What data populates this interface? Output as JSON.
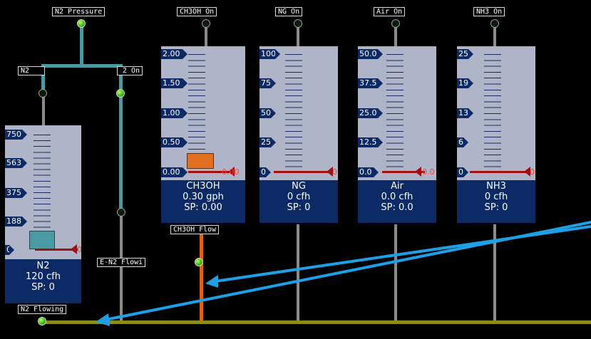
{
  "tags": {
    "n2_pressure": "N2 Pressure",
    "ch3oh_on": "CH3OH On",
    "ng_on": "NG On",
    "air_on": "Air On",
    "nh3_on": "NH3 On",
    "n2_left": "N2",
    "n2_right": "2 On",
    "e_n2_flowing": "E-N2 Flowi",
    "ch3oh_flow": "CH3OH Flow",
    "n2_flowing": "N2 Flowing"
  },
  "gauges": {
    "ch3oh": {
      "ticks": [
        "2.00",
        "1.50",
        "1.00",
        "0.50",
        "0.00"
      ],
      "zero_value": "0.00",
      "name": "CH3OH",
      "value": "0.30 gph",
      "setpoint": "SP: 0.00"
    },
    "ng": {
      "ticks": [
        "100",
        "75",
        "50",
        "25",
        "0"
      ],
      "zero_value": "0",
      "name": "NG",
      "value": "0 cfh",
      "setpoint": "SP: 0"
    },
    "air": {
      "ticks": [
        "50.0",
        "37.5",
        "25.0",
        "12.5",
        "0.0"
      ],
      "zero_value": "0.0",
      "name": "Air",
      "value": "0.0 cfh",
      "setpoint": "SP: 0.0"
    },
    "nh3": {
      "ticks": [
        "25",
        "19",
        "13",
        "6",
        "0"
      ],
      "zero_value": "0",
      "name": "NH3",
      "value": "0 cfh",
      "setpoint": "SP: 0"
    },
    "n2": {
      "ticks": [
        "750",
        "563",
        "375",
        "188",
        "0"
      ],
      "zero_value": "0",
      "name": "N2",
      "value": "120 cfh",
      "setpoint": "SP: 0"
    }
  },
  "colors": {
    "gauge_body": "#b0b4c8",
    "gauge_label": "#0b2a66",
    "led_on": "#3cb81c",
    "pipe_teal": "#4a9aa4",
    "pipe_orange": "#e06010",
    "pipe_olive": "#8c8c1c",
    "arrow": "#1ea0e6"
  }
}
